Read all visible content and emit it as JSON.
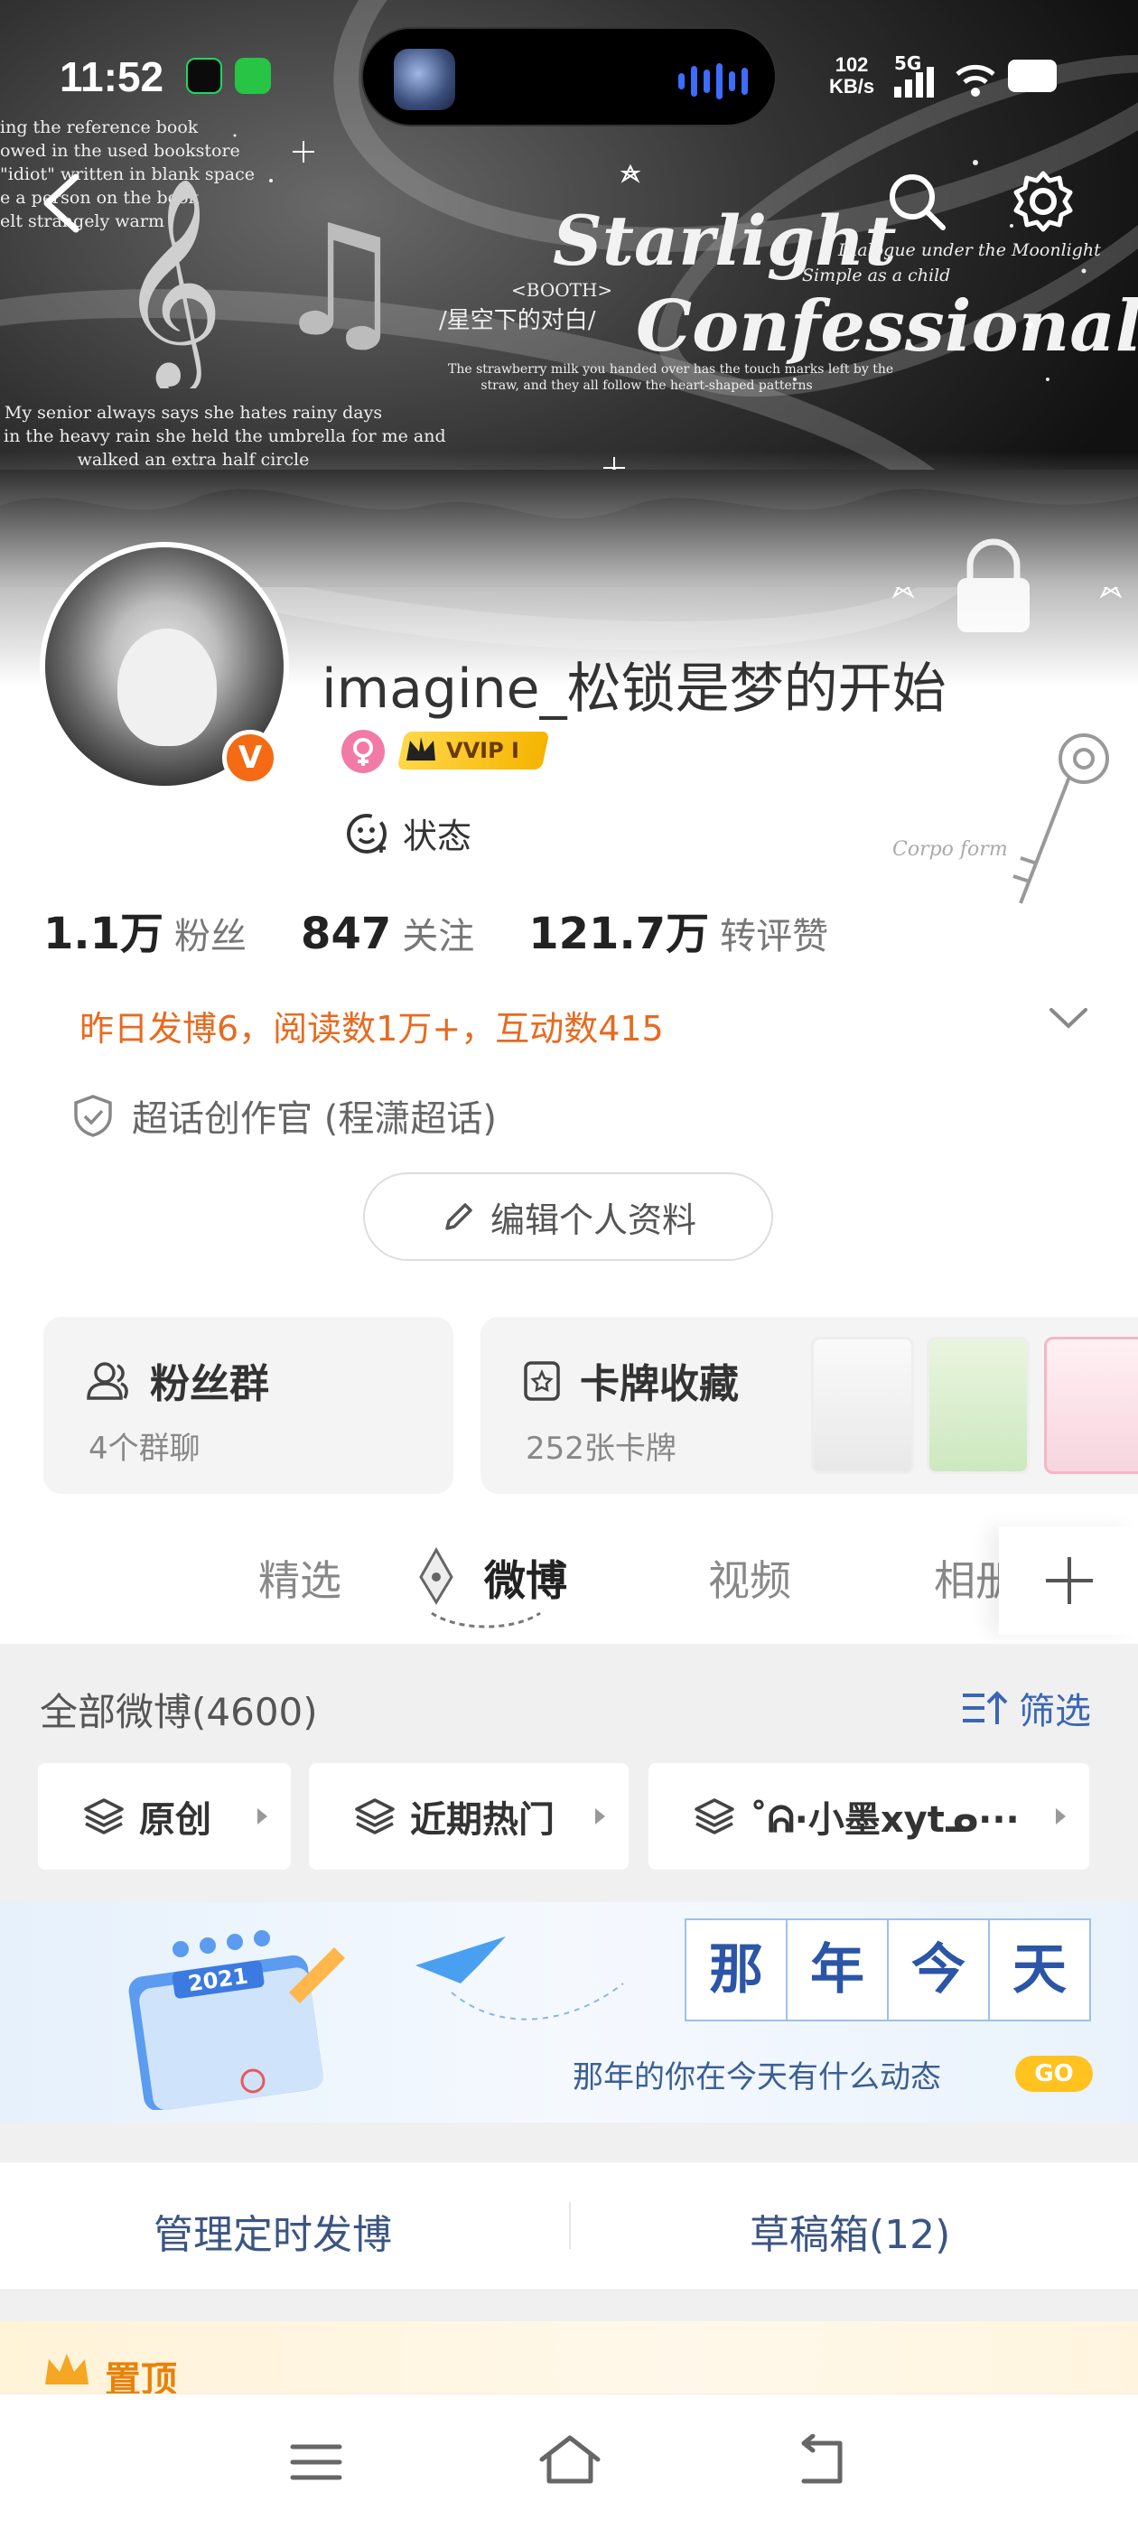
{
  "status_bar": {
    "time": "11:52",
    "net_speed_value": "102",
    "net_speed_unit": "KB/s",
    "network": "5G"
  },
  "banner": {
    "left_text_top": "ing the reference book\nowed in the used bookstore\n\"idiot\" written in blank space\ne a person on the book\nelt strangely warm",
    "left_text_bottom": "My senior always says she hates rainy days\nin the heavy rain she held the umbrella for me and\nwalked an extra half circle",
    "title_line1": "Starlight",
    "title_line2": "Confessional",
    "booth": "<BOOTH>",
    "subtitle_cn": "/星空下的对白/",
    "dialogue_line1": "Dialogue under the Moonlight",
    "dialogue_line2": "Simple as a child",
    "small_text": "The strawberry milk you handed over has the touch marks left by the\nstraw, and they all follow the heart-shaped patterns"
  },
  "profile": {
    "username": "imagine_松锁是梦的开始",
    "vip_label": "VVIP I",
    "verified_letter": "V",
    "status_label": "状态",
    "stats": [
      {
        "num": "1.1万",
        "label": "粉丝"
      },
      {
        "num": "847",
        "label": "关注"
      },
      {
        "num": "121.7万",
        "label": "转评赞"
      }
    ],
    "activity": "昨日发博6，阅读数1万+，互动数415",
    "super_topic": "超话创作官 (程潇超话)",
    "edit_button": "编辑个人资料"
  },
  "cards": {
    "fans_group_title": "粉丝群",
    "fans_group_sub": "4个群聊",
    "card_collection_title": "卡牌收藏",
    "card_collection_sub": "252张卡牌"
  },
  "tabs": [
    "精选",
    "微博",
    "视频",
    "相册"
  ],
  "feed": {
    "all_weibo": "全部微博(4600)",
    "filter": "筛选",
    "chips": [
      "原创",
      "近期热门",
      "˚ᕱ·小墨xytᓄ···"
    ]
  },
  "promo": {
    "chars": [
      "那",
      "年",
      "今",
      "天"
    ],
    "calendar_year": "2021",
    "caption": "那年的你在今天有什么动态",
    "go": "GO"
  },
  "manage": {
    "left": "管理定时发博",
    "right": "草稿箱(12)"
  },
  "pinned": "置顶",
  "colors": {
    "accent_orange": "#e86a1f",
    "link_blue": "#3a66b6",
    "vip_gold": "#f5b400",
    "verified_orange": "#f46b14"
  }
}
